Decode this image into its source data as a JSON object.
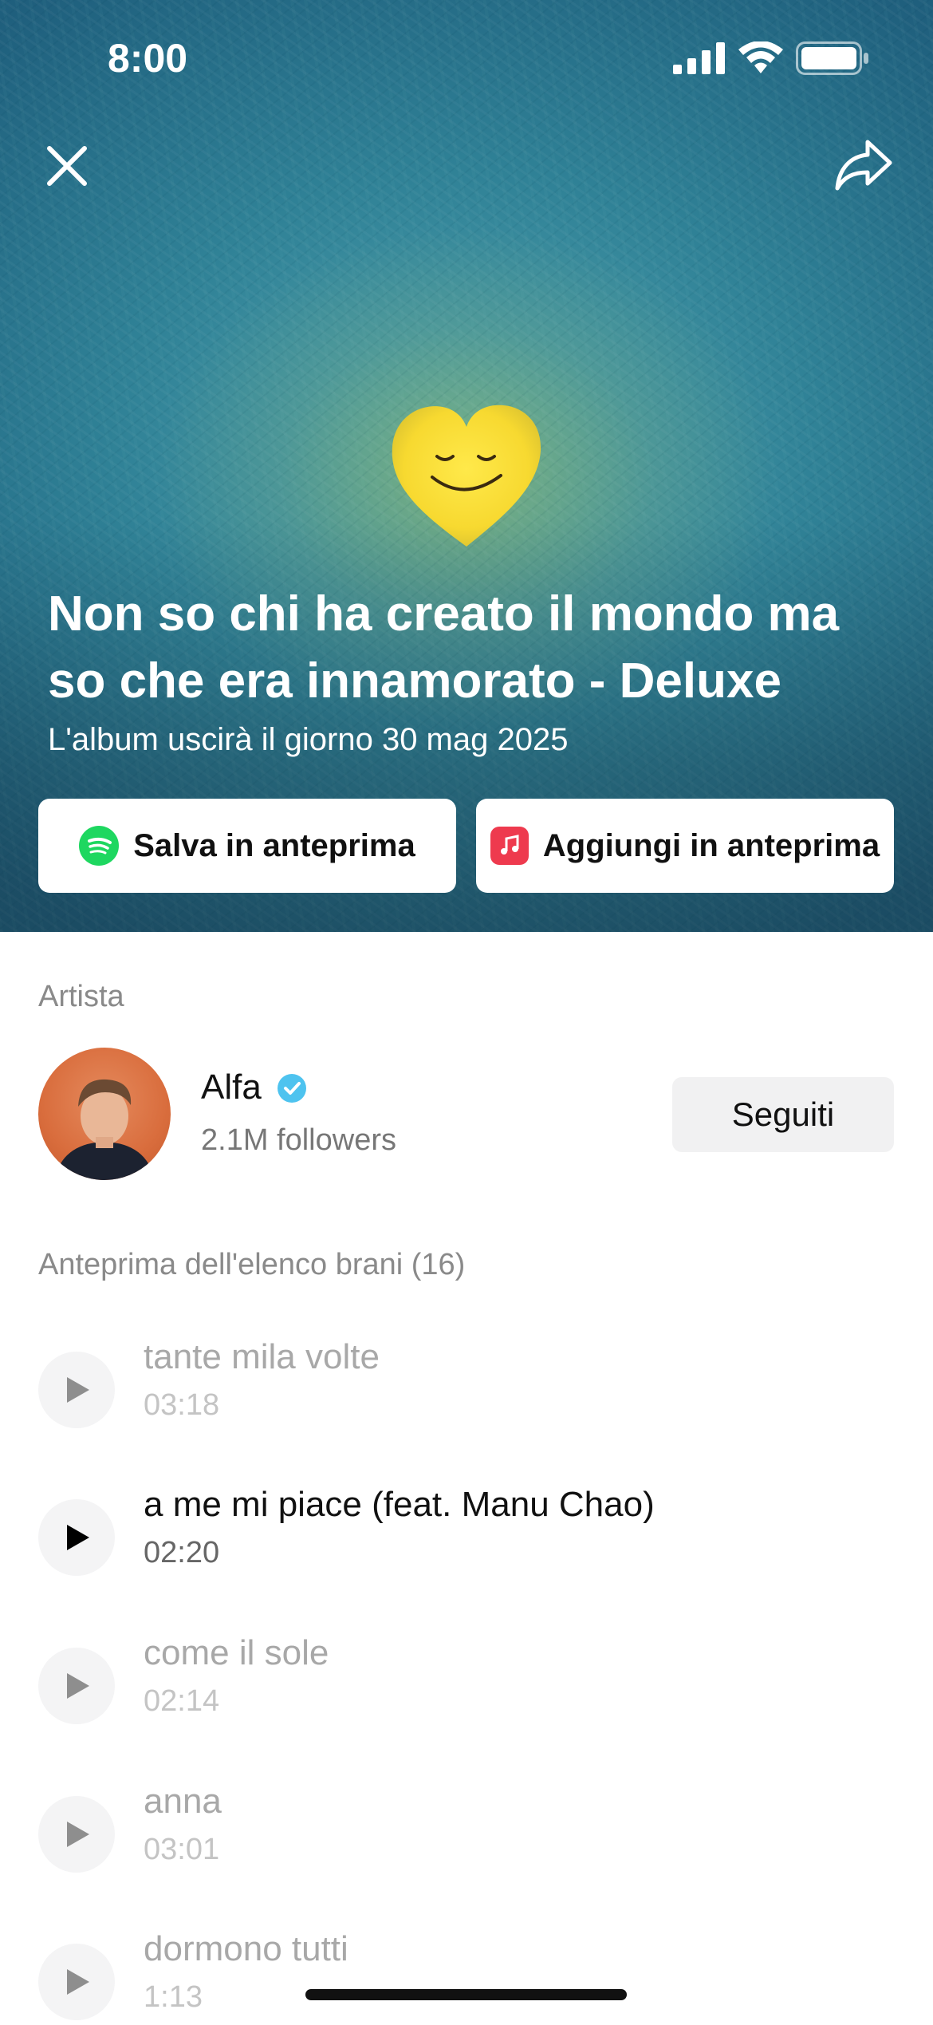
{
  "status_bar": {
    "time": "8:00"
  },
  "album": {
    "title": "Non so chi ha creato il mondo ma so che era innamorato - Deluxe",
    "release_text": "L'album uscirà il giorno 30 mag 2025"
  },
  "actions": {
    "spotify_label": "Salva in anteprima",
    "apple_label": "Aggiungi in anteprima"
  },
  "artist": {
    "section_label": "Artista",
    "name": "Alfa",
    "followers": "2.1M followers",
    "follow_label": "Seguiti"
  },
  "tracklist": {
    "section_label": "Anteprima dell'elenco brani (16)",
    "tracks": [
      {
        "title": "tante mila volte",
        "duration": "03:18",
        "playable": false
      },
      {
        "title": "a me mi piace (feat. Manu Chao)",
        "duration": "02:20",
        "playable": true
      },
      {
        "title": "come il sole",
        "duration": "02:14",
        "playable": false
      },
      {
        "title": "anna",
        "duration": "03:01",
        "playable": false
      },
      {
        "title": "dormono tutti",
        "duration": "1:13",
        "playable": false
      }
    ]
  },
  "colors": {
    "spotify_green": "#1ed760",
    "apple_red": "#ee3a4e",
    "verified_blue": "#4ec3ef"
  },
  "icons": [
    "close-icon",
    "share-icon",
    "spotify-icon",
    "apple-music-icon",
    "verified-icon",
    "play-icon"
  ]
}
